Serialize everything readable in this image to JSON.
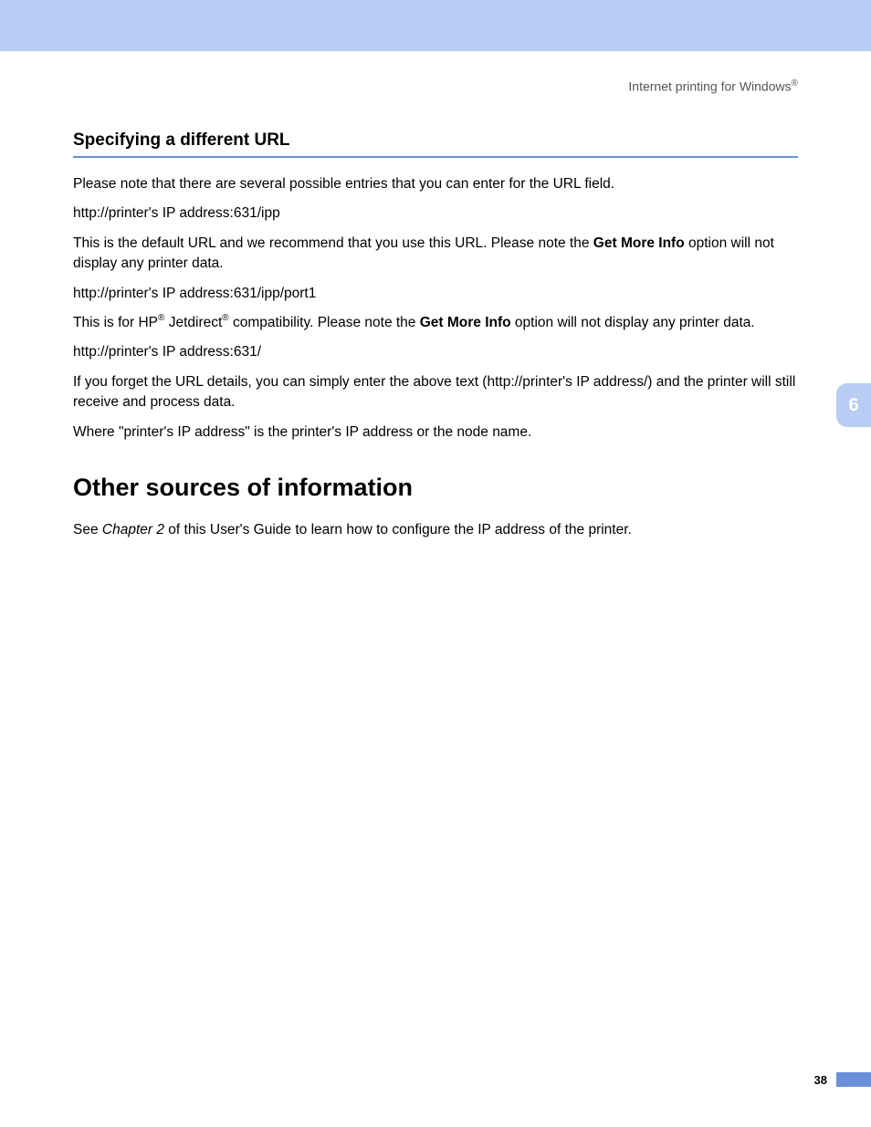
{
  "header": {
    "running_title_pre": "Internet printing for Windows",
    "running_title_sup": "®"
  },
  "section": {
    "title": "Specifying a different URL",
    "p1": "Please note that there are several possible entries that you can enter for the URL field.",
    "p2": "http://printer's IP address:631/ipp",
    "p3_a": "This is the default URL and we recommend that you use this URL. Please note the ",
    "p3_b": "Get More Info",
    "p3_c": " option will not display any printer data.",
    "p4": "http://printer's IP address:631/ipp/port1",
    "p5_a": "This is for HP",
    "p5_sup1": "®",
    "p5_b": " Jetdirect",
    "p5_sup2": "®",
    "p5_c": " compatibility. Please note the ",
    "p5_d": "Get More Info",
    "p5_e": " option will not display any printer data.",
    "p6": "http://printer's IP address:631/",
    "p7": "If you forget the URL details, you can simply enter the above text (http://printer's IP address/) and the printer will still receive and process data.",
    "p8": "Where \"printer's IP address\" is the printer's IP address or the node name."
  },
  "main_heading": "Other sources of information",
  "main_para_a": "See ",
  "main_para_em": "Chapter 2",
  "main_para_b": " of this User's Guide to learn how to configure the IP address of the printer.",
  "chapter_tab": "6",
  "page_number": "38"
}
